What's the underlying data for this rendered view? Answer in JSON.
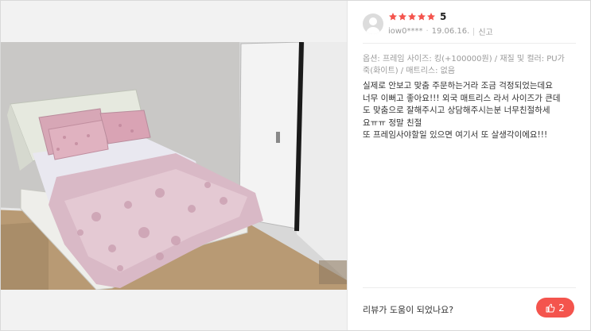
{
  "review": {
    "rating": "5",
    "stars_filled": 5,
    "star_color": "#f4544d",
    "user_id": "iow0****",
    "date": "19.06.16.",
    "report_label": "신고",
    "options_text": "옵션: 프레임 사이즈: 킹(+100000원) / 재질 및 컬러: PU가죽(화이트) / 매트리스: 없음",
    "body_lines": [
      "실제로 안보고 맞춤 주문하는거라 조금 걱정되었는데요",
      "너무 이뻐고 좋아요!!! 외국 매트리스 라서 사이즈가 큰데",
      "도 맞춤으로 잘해주시고 상담해주시는분 너무친절하세",
      "요ㅠㅠ 정말 친절",
      "또 프레임사야할일 있으면 여기서 또 살생각이에요!!!"
    ]
  },
  "helpful": {
    "question": "리뷰가 도움이 되었나요?",
    "count": "2",
    "button_color": "#f4544d"
  },
  "icons": {
    "avatar": "user-avatar-icon",
    "star": "star-icon",
    "thumbs_up": "thumbs-up-icon"
  }
}
